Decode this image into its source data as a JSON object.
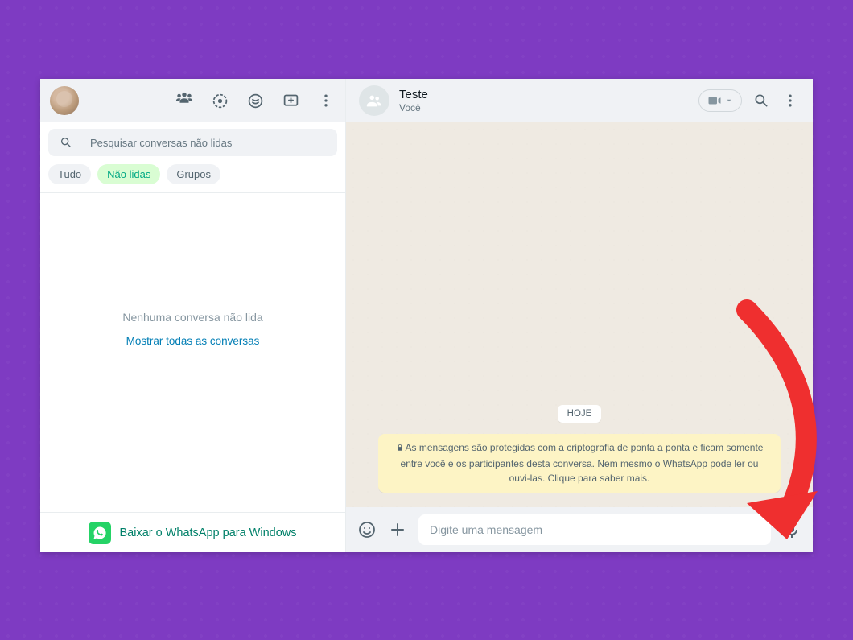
{
  "sidebar": {
    "search_placeholder": "Pesquisar conversas não lidas",
    "filters": {
      "all": "Tudo",
      "unread": "Não lidas",
      "groups": "Grupos"
    },
    "empty_message": "Nenhuma conversa não lida",
    "show_all": "Mostrar todas as conversas",
    "download_cta": "Baixar o WhatsApp para Windows"
  },
  "chat": {
    "title": "Teste",
    "subtitle": "Você",
    "date_label": "HOJE",
    "encryption_notice": "As mensagens são protegidas com a criptografia de ponta a ponta e ficam somente entre você e os participantes desta conversa. Nem mesmo o WhatsApp pode ler ou ouvi-las. Clique para saber mais."
  },
  "composer": {
    "placeholder": "Digite uma mensagem"
  },
  "colors": {
    "background": "#7e3bc2",
    "panel": "#f0f2f5",
    "accent": "#00a884",
    "link": "#027eb5",
    "chat_bg": "#efeae2",
    "notice_bg": "#fdf4c5",
    "annotation": "#ef2f2f"
  }
}
